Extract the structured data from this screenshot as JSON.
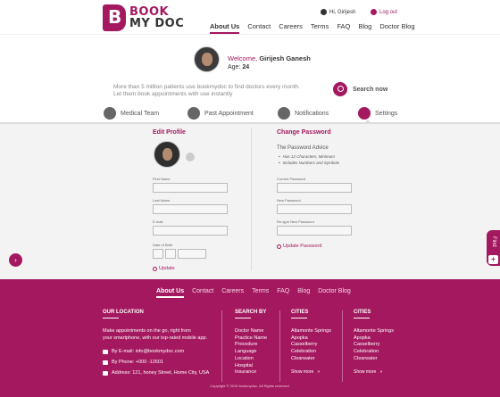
{
  "brand": {
    "line1": "BOOK",
    "line2": "MY DOC",
    "logo_letter": "B",
    "accent": "#a3185f"
  },
  "header": {
    "user_greeting": "Hi, Girijesh",
    "logout": "Log out",
    "nav": [
      "About Us",
      "Contact",
      "Careers",
      "Terms",
      "FAQ",
      "Blog",
      "Doctor Blog"
    ]
  },
  "profile": {
    "welcome_prefix": "Welcome,",
    "name": "Girijesh Ganesh",
    "age_label": "Age:",
    "age": "24",
    "tagline_1": "More than 5 million patients use bookmydoc to find doctors  every month.",
    "tagline_2": "Let them book appointments with use instantly",
    "search_label": "Search now"
  },
  "tabs": [
    {
      "label": "Medical Team",
      "icon": "user-icon"
    },
    {
      "label": "Past Appointment",
      "icon": "calendar-icon"
    },
    {
      "label": "Notifications",
      "icon": "bell-icon"
    },
    {
      "label": "Settings",
      "icon": "gear-icon"
    }
  ],
  "edit_profile": {
    "title": "Edit Profile",
    "fields": [
      {
        "label": "First Name",
        "value": ""
      },
      {
        "label": "Last Name",
        "value": ""
      },
      {
        "label": "E-mail",
        "value": ""
      }
    ],
    "dob_label": "Date of Birth",
    "update": "Update"
  },
  "change_password": {
    "title": "Change Password",
    "advice_title": "The Password Advice",
    "advice": [
      "Has 12 Characters, Minimum",
      "Includes Numbers and Symbols"
    ],
    "fields": [
      {
        "label": "Current Password",
        "value": ""
      },
      {
        "label": "New Password",
        "value": ""
      },
      {
        "label": "Re-type New Password",
        "value": ""
      }
    ],
    "update": "Update Password"
  },
  "side": {
    "find": "Find"
  },
  "footer": {
    "nav": [
      "About Us",
      "Contact",
      "Careers",
      "Terms",
      "FAQ",
      "Blog",
      "Doctor Blog"
    ],
    "location": {
      "title": "OUR LOCATION",
      "text_1": "Make appointments on the go, right from",
      "text_2": "your smartphone, with our top-rated mobile app.",
      "email": "By E-mail: info@bookmydoc.com",
      "phone": "By Phone: +000 -12601",
      "address": "Address: 121, honey Street, Home City, USA"
    },
    "search_by": {
      "title": "SEARCH BY",
      "items": [
        "Doctor Name",
        "Practice Name",
        "Procedure",
        "Language",
        "Location",
        "Hospital",
        "Insurance"
      ]
    },
    "cities_1": {
      "title": "CITIES",
      "items": [
        "Altamonte Springs",
        "Apopka",
        "Casselberry",
        "Celebration",
        "Clearwater"
      ],
      "show_more": "Show more"
    },
    "cities_2": {
      "title": "CITIES",
      "items": [
        "Altamonte Springs",
        "Apopka",
        "Casselberry",
        "Celebration",
        "Clearwater"
      ],
      "show_more": "Show more"
    },
    "copyright": "Copyright © 2016 bookmydoc. All Rights reserved."
  }
}
